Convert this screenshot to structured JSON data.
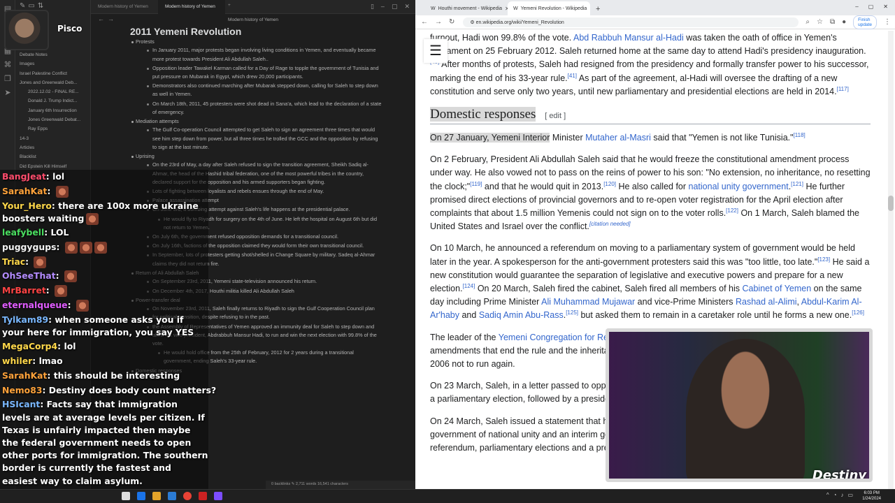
{
  "obsidian": {
    "tabs": [
      "Modern history of Yemen",
      "Modern history of Yemen"
    ],
    "header": "Modern history of Yemen",
    "sidebar_items": [
      {
        "label": "Debate Notes",
        "level": 1
      },
      {
        "label": "Images",
        "level": 1
      },
      {
        "label": "Israel Palestine Conflict",
        "level": 1
      },
      {
        "label": "Jones and Greenwald Deb...",
        "level": 1
      },
      {
        "label": "2022.12.02 - FINAL RE...",
        "level": 2
      },
      {
        "label": "Donald J. Trump Indict...",
        "level": 2
      },
      {
        "label": "January 6th Insurrection",
        "level": 2
      },
      {
        "label": "Jones Greenwald Debat...",
        "level": 2
      },
      {
        "label": "Ray Epps",
        "level": 2
      },
      {
        "label": "14-3",
        "level": 1
      },
      {
        "label": "Articles",
        "level": 1
      },
      {
        "label": "Blacklist",
        "level": 1
      },
      {
        "label": "Did Epstein Kill Himself",
        "level": 1
      }
    ],
    "title": "2011 Yemeni Revolution",
    "outline": [
      {
        "type": "sec",
        "text": "Protests"
      },
      {
        "type": "bul",
        "text": "In January 2011, major protests began involving living conditions in Yemen, and eventually became more protest towards President Ali Abdullah Saleh.."
      },
      {
        "type": "bul",
        "text": "Opposition leader Tawakel Karman called for a Day of Rage to topple the government of Tunisia and put pressure on Mubarak in Egypt, which drew 20,000 participants."
      },
      {
        "type": "bul",
        "text": "Demonstrators also continued marching after Mubarak stepped down, calling for Saleh to step down as well in Yemen."
      },
      {
        "type": "bul",
        "text": "On March 18th, 2011, 45 protesters were shot dead in Sana'a, which lead to the declaration of a state of emergency."
      },
      {
        "type": "sec",
        "text": "Mediation attempts"
      },
      {
        "type": "bul",
        "text": "The Gulf Co-operation Council attempted to get Saleh to sign an agreement three times that would see him step down from power, but all three times he trolled the GCC and the opposition by refusing to sign at the last minute."
      },
      {
        "type": "sec",
        "text": "Uprising"
      },
      {
        "type": "bul",
        "text": "On the 23rd of May, a day after Saleh refused to sign the transition agreement, Sheikh Sadiq al-Ahmar, the head of the Hashid tribal federation, one of the most powerful tribes in the country, declared support for the opposition and his armed supporters began fighting."
      },
      {
        "type": "bul",
        "text": "Lots of fighting between loyalists and rebels ensues through the end of May."
      },
      {
        "type": "bul",
        "text": "Palace assassination attempt"
      },
      {
        "type": "bul",
        "text": "On June 3rd, a bombing attempt against Saleh's life happens at the presidential palace."
      },
      {
        "type": "deep",
        "text": "He would fly to Riyadh for surgery on the 4th of June. He left the hospital on August 6th but did not return to Yemen."
      },
      {
        "type": "bul",
        "text": "On July 6th, the government refused opposition demands for a transitional council."
      },
      {
        "type": "bul",
        "text": "On July 16th, factions of the opposition claimed they would form their own transitional council."
      },
      {
        "type": "bul",
        "text": "In September, lots of protesters getting shot/shelled in Change Square by military. Sadeq al-Ahmar claims they did not return fire."
      },
      {
        "type": "sec",
        "text": "Return of Ali Abdullah Saleh"
      },
      {
        "type": "bul",
        "text": "On September 23rd, 2011, Yemeni state-television announced his return."
      },
      {
        "type": "bul",
        "text": "On December 4th, 2017, Houthi militia killed Ali Abdullah Saleh"
      },
      {
        "type": "sec",
        "text": "Power-transfer deal"
      },
      {
        "type": "bul",
        "text": "On November 23rd, 2011, Saleh finally returns to Riyadh to sign the Gulf Cooperation Council plan for political transition, despite refusing to in the past."
      },
      {
        "type": "bul",
        "text": "the Assembly of Representatives of Yemen approved an immunity deal for Saleh to step down and allow his vice president, Abdrabbuh Mansur Hadi, to run and win the next election with 99.8% of the vote."
      },
      {
        "type": "deep",
        "text": "He would hold office from the 25th of February, 2012 for 2 years during a transitional government, ending Saleh's 33-year rule."
      },
      {
        "type": "sec",
        "text": "Domestic responses"
      }
    ],
    "status": "0 backlinks  ✎ 2,711 words  16,541 characters"
  },
  "streamer": {
    "name": "Pisco"
  },
  "chat": [
    {
      "user": "BangJeat",
      "color": "#ff4d6d",
      "text": "lol",
      "emotes": 0
    },
    {
      "user": "SarahKat",
      "color": "#ffa23a",
      "text": "",
      "emotes": 1
    },
    {
      "user": "Your_Hero",
      "color": "#ffd84a",
      "text": "there are 100x more ukraine boosters waiting",
      "emotes": 1,
      "wrap": true
    },
    {
      "user": "leafybell",
      "color": "#4ade60",
      "text": "LOL",
      "emotes": 0
    },
    {
      "user": "puggygups",
      "color": "#f4f4f4",
      "text": "",
      "emotes": 3
    },
    {
      "user": "Triac",
      "color": "#ffd84a",
      "text": "",
      "emotes": 1
    },
    {
      "user": "OhSeeThat",
      "color": "#b48cff",
      "text": "",
      "emotes": 1
    },
    {
      "user": "MrBarret",
      "color": "#ff4444",
      "text": "",
      "emotes": 1
    },
    {
      "user": "eternalqueue",
      "color": "#e05cff",
      "text": "",
      "emotes": 1
    },
    {
      "user": "Tylkam89",
      "color": "#7ab8ff",
      "text": "when someone asks you if your here for immigration, you say YES",
      "emotes": 0,
      "wrap": true
    },
    {
      "user": "MegaCorp4",
      "color": "#ffd84a",
      "text": "lol",
      "emotes": 0
    },
    {
      "user": "whiler",
      "color": "#ffd84a",
      "text": "lmao",
      "emotes": 0
    },
    {
      "user": "SarahKat",
      "color": "#ffa23a",
      "text": "this should be interesting",
      "emotes": 0
    },
    {
      "user": "Nemo83",
      "color": "#ffa23a",
      "text": "Destiny does body count matters?",
      "emotes": 0
    },
    {
      "user": "HSIcant",
      "color": "#7ab8ff",
      "text": "Facts say that immigration levels are at average levels per citizen. If Texas is unfairly impacted then maybe the federal government needs to open other ports for immigration. The southern border is currently the fastest and easiest way to claim asylum.",
      "emotes": 0,
      "wrap": true
    }
  ],
  "chrome": {
    "tabs": [
      {
        "title": "Houthi movement - Wikipedia",
        "active": false
      },
      {
        "title": "Yemeni Revolution - Wikipedia",
        "active": true
      }
    ],
    "url": "en.wikipedia.org/wiki/Yemeni_Revolution",
    "finish_update": "Finish update"
  },
  "wiki": {
    "p0": [
      {
        "t": "furnout, Hadi won 99.8% of the vote. "
      },
      {
        "t": "Abd Rabbuh Mansur al-Hadi",
        "link": true
      },
      {
        "t": " was taken the oath of office in Yemen's parliament on 25 February 2012. Saleh returned home at the same day to attend Hadi's presidency inauguration."
      },
      {
        "t": "[40]",
        "cite": true
      },
      {
        "t": " After months of protests, Saleh had resigned from the presidency and formally transfer power to his successor, marking the end of his 33-year rule."
      },
      {
        "t": "[41]",
        "cite": true
      },
      {
        "t": " As part of the agreement, al-Hadi will oversee the drafting of a new constitution and serve only two years, until new parliamentary and presidential elections are held in 2014."
      },
      {
        "t": "[117]",
        "cite": true
      }
    ],
    "heading": "Domestic responses",
    "edit": "[ edit ]",
    "p1": [
      {
        "t": "On 27 January, Yemeni Interior",
        "hl": true
      },
      {
        "t": " Minister "
      },
      {
        "t": "Mutaher al-Masri",
        "link": true
      },
      {
        "t": " said that \"Yemen is not like Tunisia.\""
      },
      {
        "t": "[118]",
        "cite": true
      }
    ],
    "p2": [
      {
        "t": "On 2 February, President Ali Abdullah Saleh said that he would freeze the constitutional amendment process under way. He also vowed not to pass on the reins of power to his son: \"No extension, no inheritance, no resetting the clock;\""
      },
      {
        "t": "[119]",
        "cite": true
      },
      {
        "t": " and that he would quit in 2013."
      },
      {
        "t": "[120]",
        "cite": true
      },
      {
        "t": " He also called for "
      },
      {
        "t": "national unity government",
        "link": true
      },
      {
        "t": "."
      },
      {
        "t": "[121]",
        "cite": true
      },
      {
        "t": " He further promised direct elections of provincial governors and to re-open voter registration for the April election after complaints that about 1.5 million Yemenis could not sign on to the voter rolls."
      },
      {
        "t": "[122]",
        "cite": true
      },
      {
        "t": " On 1 March, Saleh blamed the United States and Israel over the conflict."
      },
      {
        "t": "[citation needed]",
        "cn": true
      }
    ],
    "p3": [
      {
        "t": "On 10 March, he announced a referendum on moving to a parliamentary system of government would be held later in the year. A spokesperson for the anti-government protesters said this was \"too little, too late.\""
      },
      {
        "t": "[123]",
        "cite": true
      },
      {
        "t": " He said a new constitution would guarantee the separation of legislative and executive powers and prepare for a new election."
      },
      {
        "t": "[124]",
        "cite": true
      },
      {
        "t": " On 20 March, Saleh fired the cabinet, Saleh fired all members of his "
      },
      {
        "t": "Cabinet of Yemen",
        "link": true
      },
      {
        "t": " on the same day including Prime Minister "
      },
      {
        "t": "Ali Muhammad Mujawar",
        "link": true
      },
      {
        "t": " and vice-Prime Ministers "
      },
      {
        "t": "Rashad al-Alimi",
        "link": true
      },
      {
        "t": ", "
      },
      {
        "t": "Abdul-Karim Al-Ar'haby",
        "link": true
      },
      {
        "t": " and "
      },
      {
        "t": "Sadiq Amin Abu-Rass",
        "link": true
      },
      {
        "t": "."
      },
      {
        "t": "[125]",
        "cite": true
      },
      {
        "t": " but asked them to remain in a caretaker role until he forms a new one."
      },
      {
        "t": "[126]",
        "cite": true
      }
    ],
    "p4": [
      {
        "t": "The leader of the "
      },
      {
        "t": "Yemeni Congregation for Refo",
        "link": true
      },
      {
        "t": "rm, Mohammed Sabry, stated, \"We want constitutional amendments that end the rule and the inheritance of power to his children...\" Sabry said Saleh made a promise in 2006 not to run again."
      }
    ],
    "p5": [
      {
        "t": "On 23 March, Saleh, in a letter passed to opposition leaders, offered to step down by the end of the year and then a parliamentary election, followed by a presidential election. Opposition leaders were studying the offer."
      },
      {
        "t": "[128]",
        "cite": true
      }
    ],
    "p6": [
      {
        "t": "On 24 March, Saleh issued a statement that he would call on the parliament to approve the formation of a government of national unity and an interim government, a new electoral law, and holding a constitutional referendum, parliamentary elections and a presidential vote."
      }
    ]
  },
  "cam": {
    "logo": "Destiny"
  },
  "taskbar": {
    "time": "6:03 PM",
    "date": "1/24/2024"
  }
}
